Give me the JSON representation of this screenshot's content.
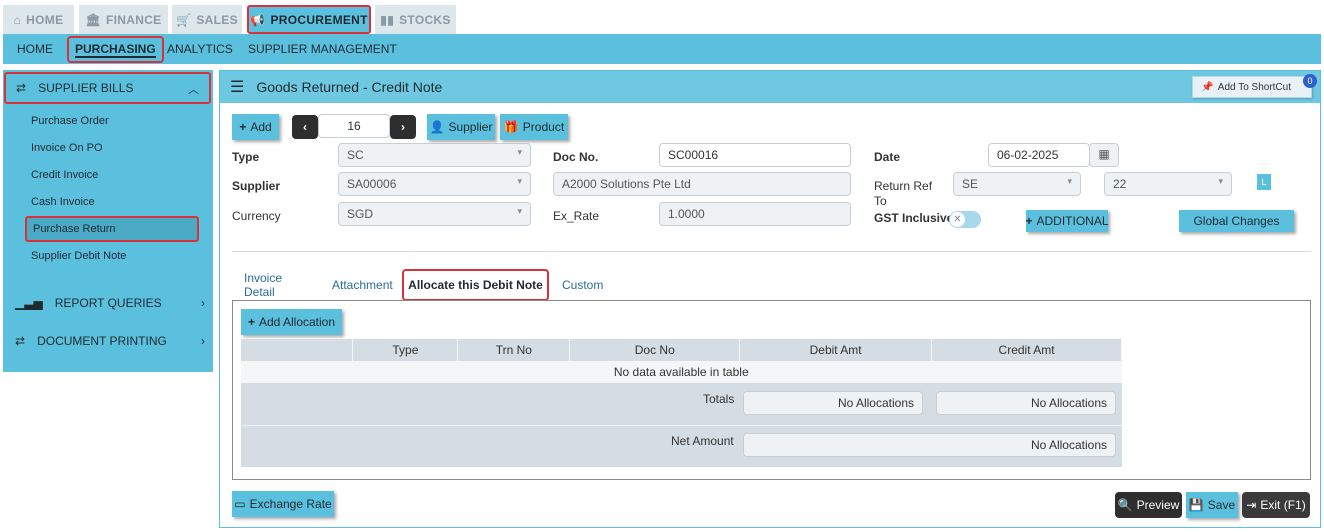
{
  "top_tabs": [
    {
      "label": "HOME",
      "icon": "home-icon"
    },
    {
      "label": "FINANCE",
      "icon": "bank-icon"
    },
    {
      "label": "SALES",
      "icon": "cart-icon"
    },
    {
      "label": "PROCUREMENT",
      "icon": "megaphone-icon"
    },
    {
      "label": "STOCKS",
      "icon": "bar-chart-icon"
    }
  ],
  "sub_menu": [
    "HOME",
    "PURCHASING",
    "ANALYTICS",
    "SUPPLIER MANAGEMENT"
  ],
  "sidebar": {
    "section_title": "SUPPLIER BILLS",
    "links": [
      "Purchase Order",
      "Invoice On PO",
      "Credit Invoice",
      "Cash Invoice",
      "Purchase Return",
      "Supplier Debit Note"
    ],
    "sections": [
      "REPORT QUERIES",
      "DOCUMENT PRINTING"
    ]
  },
  "page": {
    "title": "Goods Returned - Credit Note",
    "shortcut_label": "Add To ShortCut",
    "shortcut_count": "0"
  },
  "toolbar": {
    "add": "Add",
    "record_no": "16",
    "supplier": "Supplier",
    "product": "Product"
  },
  "form": {
    "type_label": "Type",
    "type_value": "SC",
    "docno_label": "Doc No.",
    "docno_value": "SC00016",
    "date_label": "Date",
    "date_value": "06-02-2025",
    "supplier_label": "Supplier",
    "supplier_value": "SA00006",
    "supplier_name": "A2000 Solutions Pte Ltd",
    "return_ref_label_1": "Return Ref",
    "return_ref_label_2": "To",
    "return_ref_value": "SE",
    "return_ref_no": "22",
    "l_badge": "L",
    "currency_label": "Currency",
    "currency_value": "SGD",
    "exrate_label": "Ex_Rate",
    "exrate_value": "1.0000",
    "gst_label": "GST Inclusive",
    "additional": "ADDITIONAL",
    "global_changes": "Global Changes"
  },
  "detail_tabs": [
    "Invoice Detail",
    "Attachment",
    "Allocate this Debit Note",
    "Custom"
  ],
  "allocation": {
    "add_button": "Add Allocation",
    "columns": [
      "Type",
      "Trn No",
      "Doc No",
      "Debit Amt",
      "Credit Amt"
    ],
    "empty_text": "No data available in table",
    "totals_label": "Totals",
    "net_label": "Net Amount",
    "no_alloc": "No Allocations"
  },
  "footer": {
    "exchange_rate": "Exchange Rate",
    "preview": "Preview",
    "save": "Save",
    "exit": "Exit (F1)"
  },
  "colors": {
    "accent": "#5bc0de",
    "highlight": "#d9323a",
    "dark_button": "#2e2e2e"
  }
}
